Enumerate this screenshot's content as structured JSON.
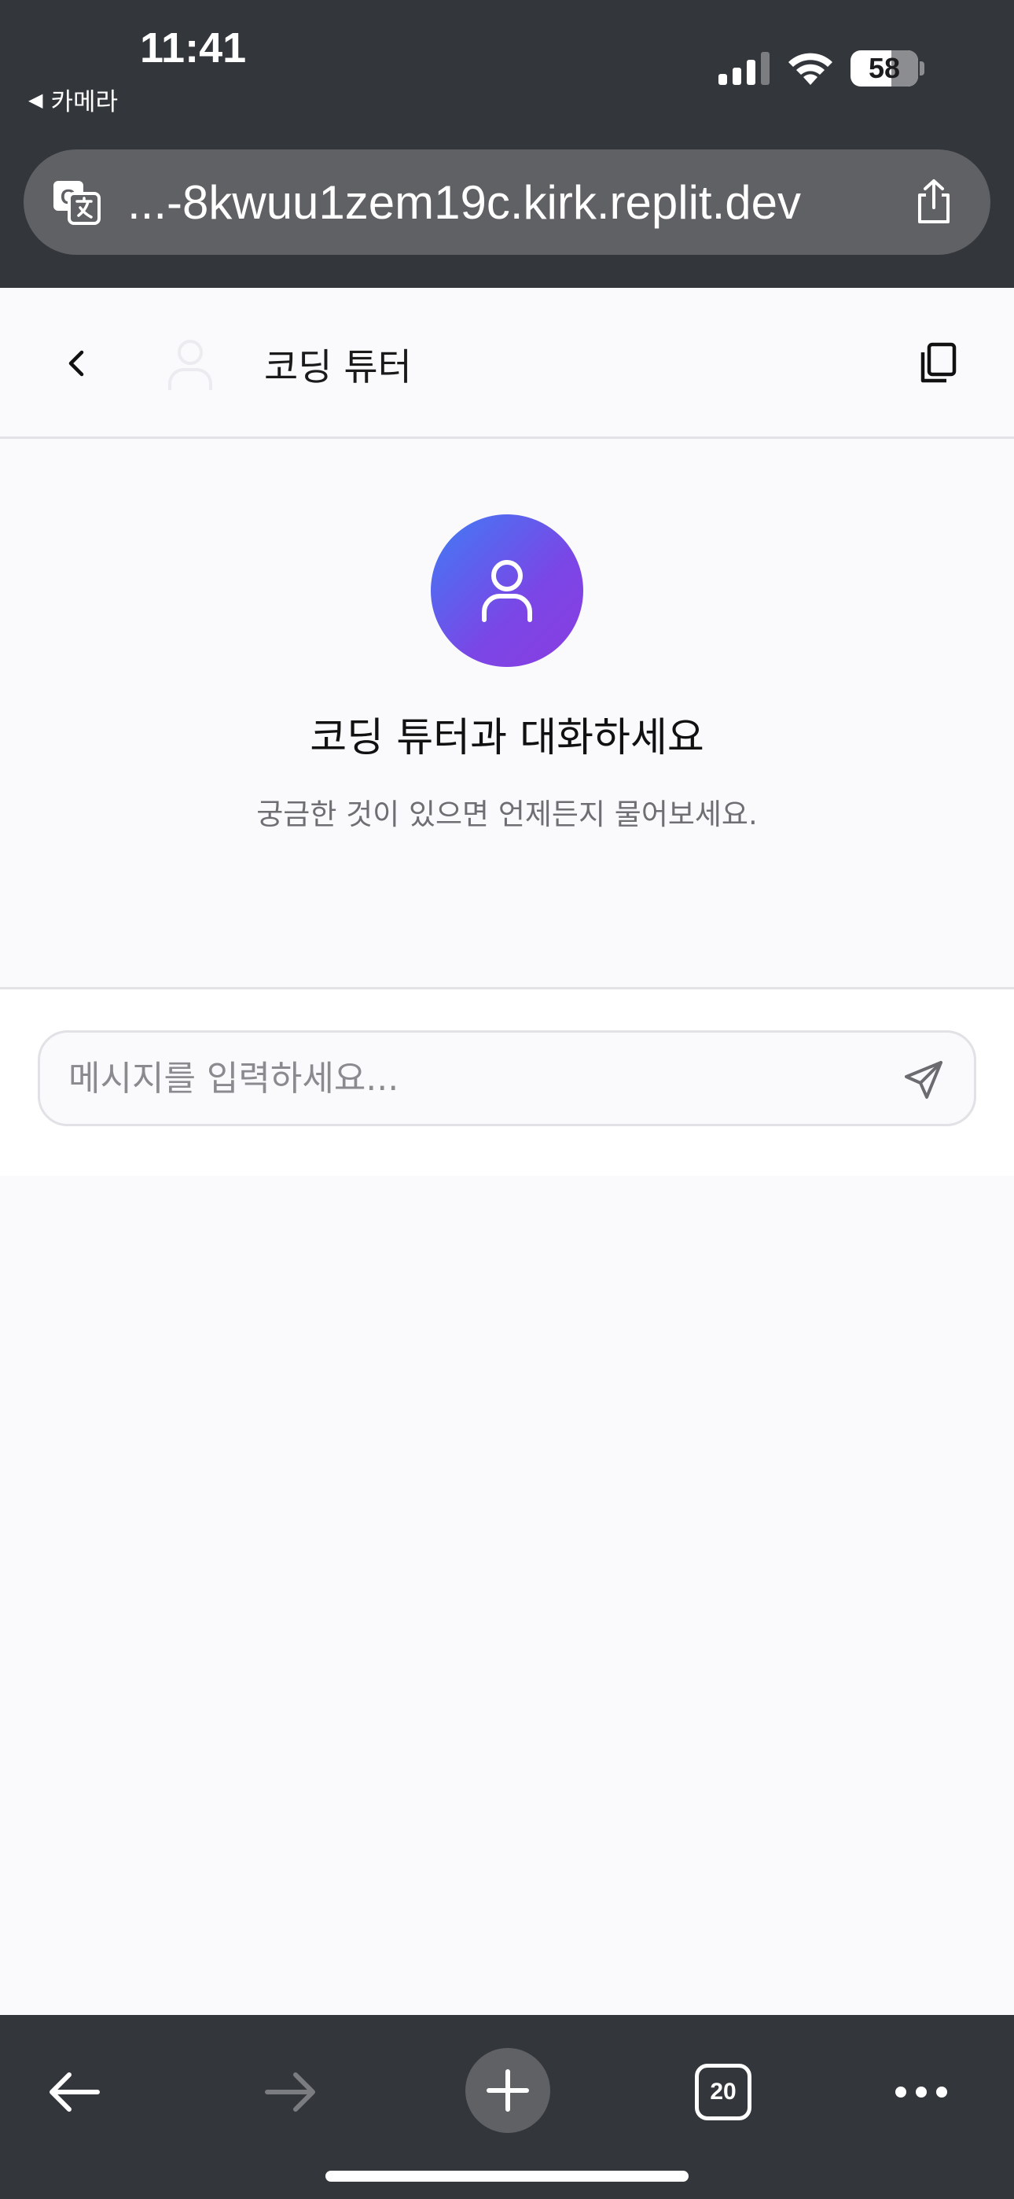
{
  "status_bar": {
    "time": "11:41",
    "back_app_label": "카메라",
    "battery_level": "58"
  },
  "browser": {
    "url": "...-8kwuu1zem19c.kirk.replit.dev",
    "open_tabs": "20"
  },
  "header": {
    "title": "코딩 튜터"
  },
  "empty_state": {
    "title": "코딩 튜터과 대화하세요",
    "subtitle": "궁금한 것이 있으면 언제든지 물어보세요."
  },
  "composer": {
    "placeholder": "메시지를 입력하세요...",
    "value": ""
  },
  "colors": {
    "chrome_bg": "#33363b",
    "avatar_gradient_start": "#3f7cf4",
    "avatar_gradient_end": "#8a3de0"
  }
}
